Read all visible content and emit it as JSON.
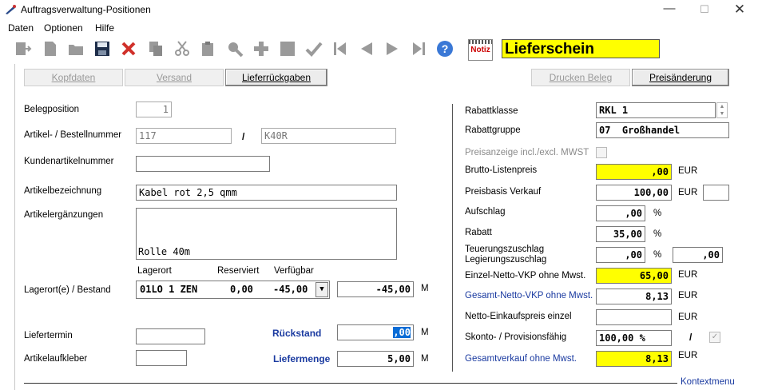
{
  "window": {
    "title": "Auftragsverwaltung-Positionen"
  },
  "menu": [
    "Daten",
    "Optionen",
    "Hilfe"
  ],
  "toolbar": {
    "notiz": "Notiz",
    "doc_type": "Lieferschein"
  },
  "buttons": {
    "kopfdaten": "Kopfdaten",
    "versand": "Versand",
    "lieferrueckgaben": "Lieferrückgaben",
    "drucken": "Drucken Beleg",
    "preisaenderung": "Preisänderung"
  },
  "left": {
    "belegposition_label": "Belegposition",
    "belegposition": "1",
    "artikel_label": "Artikel- / Bestellnummer",
    "artikel": "117",
    "slash": "/",
    "bestellnummer": "K40R",
    "kundenartikel_label": "Kundenartikelnummer",
    "kundenartikel": "",
    "bezeichnung_label": "Artikelbezeichnung",
    "bezeichnung": "Kabel rot 2,5 qmm",
    "ergaenzungen_label": "Artikelergänzungen",
    "ergaenzungen": "Rolle 40m",
    "col_lagerort": "Lagerort",
    "col_reserviert": "Reserviert",
    "col_verfuegbar": "Verfügbar",
    "lager_label": "Lagerort(e) / Bestand",
    "lager_ort": "01LO 1 ZEN",
    "lager_reserviert": "0,00",
    "lager_verfuegbar": "-45,00",
    "bestand": "-45,00",
    "unit_m": "M",
    "liefertermin_label": "Liefertermin",
    "liefertermin": "",
    "rueckstand_label": "Rückstand",
    "rueckstand": ",00",
    "aufkleber_label": "Artikelaufkleber",
    "aufkleber": "",
    "liefermenge_label": "Liefermenge",
    "liefermenge": "5,00"
  },
  "right": {
    "rabattklasse_label": "Rabattklasse",
    "rabattklasse": "RKL 1",
    "rabattgruppe_label": "Rabattgruppe",
    "rabattgruppe": "07  Großhandel",
    "preisanzeige_label": "Preisanzeige incl./excl. MWST",
    "brutto_label": "Brutto-Listenpreis",
    "brutto": ",00",
    "preisbasis_label": "Preisbasis Verkauf",
    "preisbasis": "100,00",
    "preisbasis_waehrung": "",
    "aufschlag_label": "Aufschlag",
    "aufschlag": ",00",
    "rabatt_label": "Rabatt",
    "rabatt": "35,00",
    "teuerung_label": "Teuerungszuschlag",
    "legierung_label": "Legierungszuschlag",
    "teuerung": ",00",
    "legierung": ",00",
    "einzel_label": "Einzel-Netto-VKP ohne Mwst.",
    "einzel": "65,00",
    "gesamt_netto_label": "Gesamt-Netto-VKP ohne Mwst.",
    "gesamt_netto": "8,13",
    "ek_label": "Netto-Einkaufspreis einzel",
    "ek": "",
    "skonto_label": "Skonto- / Provisionsfähig",
    "skonto": "100,00 %",
    "slash": "/",
    "gesamtvk_label": "Gesamtverkauf ohne Mwst.",
    "gesamtvk": "8,13",
    "eur": "EUR",
    "pct": "%"
  },
  "footer": {
    "kontextmenu": "Kontextmenu"
  },
  "colors": {
    "highlight": "#ffff00",
    "label_blue": "#1a3aa0",
    "selection": "#0a6cd6"
  }
}
